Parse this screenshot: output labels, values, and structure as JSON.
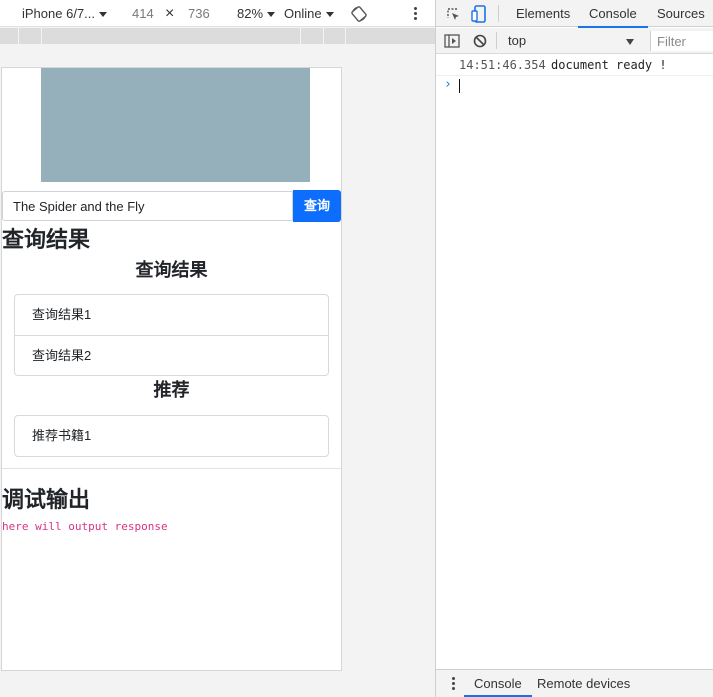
{
  "device_toolbar": {
    "device_name": "iPhone 6/7...",
    "width": "414",
    "times": "×",
    "height": "736",
    "zoom": "82%",
    "network": "Online",
    "icons": [
      "rotate-icon",
      "more-icon"
    ]
  },
  "page": {
    "banner_color": "#95afbb",
    "search": {
      "value": "The Spider and the Fly",
      "button_label": "查询"
    },
    "results_heading": "查询结果",
    "results_subtitle": "查询结果",
    "results": [
      "查询结果1",
      "查询结果2"
    ],
    "recommend_title": "推荐",
    "recommendations": [
      "推荐书籍1"
    ],
    "debug_heading": "调试输出",
    "debug_output": "here will output response",
    "accent_color": "#0d6efd"
  },
  "devtools": {
    "tabs": [
      "Elements",
      "Console",
      "Sources"
    ],
    "active_tab": "Console",
    "icons": [
      "inspect-element-icon",
      "device-toggle-icon",
      "sidebar-toggle-icon",
      "clear-console-icon"
    ],
    "context": "top",
    "filter_placeholder": "Filter",
    "logs": [
      {
        "time": "14:51:46.354",
        "message": "document ready !"
      }
    ],
    "prompt_symbol": "›",
    "drawer": {
      "tabs": [
        "Console",
        "Remote devices"
      ],
      "active": "Console"
    },
    "accent_color": "#1a73e8"
  }
}
